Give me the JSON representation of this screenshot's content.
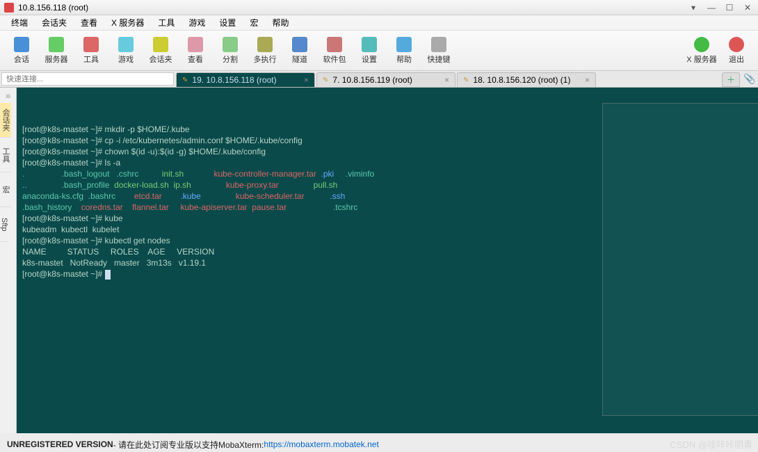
{
  "window": {
    "title": "10.8.156.118 (root)"
  },
  "menubar": [
    "终端",
    "会话夹",
    "查看",
    "X 服务器",
    "工具",
    "游戏",
    "设置",
    "宏",
    "帮助"
  ],
  "toolbar": [
    {
      "label": "会话",
      "color": "#4a90d9"
    },
    {
      "label": "服务器",
      "color": "#6c6"
    },
    {
      "label": "工具",
      "color": "#d66"
    },
    {
      "label": "游戏",
      "color": "#6cd"
    },
    {
      "label": "会话夹",
      "color": "#cc3"
    },
    {
      "label": "查看",
      "color": "#d9a"
    },
    {
      "label": "分割",
      "color": "#8c8"
    },
    {
      "label": "多执行",
      "color": "#aa5"
    },
    {
      "label": "隧道",
      "color": "#58c"
    },
    {
      "label": "软件包",
      "color": "#c77"
    },
    {
      "label": "设置",
      "color": "#5bb"
    },
    {
      "label": "帮助",
      "color": "#5ad"
    },
    {
      "label": "快捷键",
      "color": "#aaa"
    }
  ],
  "toolbar_right": [
    {
      "label": "X 服务器",
      "color": "#4b4"
    },
    {
      "label": "退出",
      "color": "#d55"
    }
  ],
  "quick_connect_placeholder": "快速连接...",
  "tabs": [
    {
      "label": "19. 10.8.156.118 (root)",
      "active": true
    },
    {
      "label": "7. 10.8.156.119 (root)",
      "active": false
    },
    {
      "label": "18. 10.8.156.120 (root) (1)",
      "active": false
    }
  ],
  "sidebar": [
    {
      "label": "会话夹",
      "cls": "y"
    },
    {
      "label": "工具",
      "cls": ""
    },
    {
      "label": "宏",
      "cls": ""
    },
    {
      "label": "Sftp",
      "cls": ""
    }
  ],
  "terminal": {
    "lines": [
      {
        "t": "[root@k8s-mastet ~]# mkdir -p $HOME/.kube",
        "seg": [
          [
            "p",
            "[root@k8s-mastet ~]# mkdir -p $HOME/.kube"
          ]
        ]
      },
      {
        "t": "",
        "seg": [
          [
            "p",
            "[root@k8s-mastet ~]# cp -i /etc/kubernetes/admin.conf $HOME/.kube/config"
          ]
        ]
      },
      {
        "t": "",
        "seg": [
          [
            "p",
            "[root@k8s-mastet ~]# chown $(id -u):$(id -g) $HOME/.kube/config"
          ]
        ]
      },
      {
        "t": "",
        "seg": [
          [
            "p",
            "[root@k8s-mastet ~]# ls -a"
          ]
        ]
      },
      {
        "t": "",
        "seg": [
          [
            "c-blue",
            ".                "
          ],
          [
            "c-cyan",
            ".bash_logout   "
          ],
          [
            "c-cyan",
            ".cshrc          "
          ],
          [
            "c-green",
            "init.sh             "
          ],
          [
            "c-red",
            "kube-controller-manager.tar  "
          ],
          [
            "c-blue",
            ".pki     "
          ],
          [
            "c-cyan",
            ".viminfo"
          ]
        ]
      },
      {
        "t": "",
        "seg": [
          [
            "c-blue",
            "..               "
          ],
          [
            "c-cyan",
            ".bash_profile  "
          ],
          [
            "c-green",
            "docker-load.sh  "
          ],
          [
            "c-green",
            "ip.sh               "
          ],
          [
            "c-red",
            "kube-proxy.tar               "
          ],
          [
            "c-green",
            "pull.sh"
          ]
        ]
      },
      {
        "t": "",
        "seg": [
          [
            "c-cyan",
            "anaconda-ks.cfg  "
          ],
          [
            "c-cyan",
            ".bashrc        "
          ],
          [
            "c-red",
            "etcd.tar        "
          ],
          [
            "c-blue",
            ".kube               "
          ],
          [
            "c-red",
            "kube-scheduler.tar           "
          ],
          [
            "c-blue",
            ".ssh"
          ]
        ]
      },
      {
        "t": "",
        "seg": [
          [
            "c-cyan",
            ".bash_history    "
          ],
          [
            "c-red",
            "coredns.tar    "
          ],
          [
            "c-red",
            "flannel.tar     "
          ],
          [
            "c-red",
            "kube-apiserver.tar  "
          ],
          [
            "c-red",
            "pause.tar                    "
          ],
          [
            "c-cyan",
            ".tcshrc"
          ]
        ]
      },
      {
        "t": "",
        "seg": [
          [
            "p",
            "[root@k8s-mastet ~]# kube"
          ]
        ]
      },
      {
        "t": "",
        "seg": [
          [
            "p",
            "kubeadm  kubectl  kubelet"
          ]
        ]
      },
      {
        "t": "",
        "seg": [
          [
            "p",
            "[root@k8s-mastet ~]# kubectl get nodes"
          ]
        ]
      },
      {
        "t": "",
        "seg": [
          [
            "p",
            "NAME         STATUS     ROLES    AGE     VERSION"
          ]
        ]
      },
      {
        "t": "",
        "seg": [
          [
            "p",
            "k8s-mastet   NotReady   master   3m13s   v1.19.1"
          ]
        ]
      },
      {
        "t": "",
        "seg": [
          [
            "p",
            "[root@k8s-mastet ~]# "
          ],
          [
            "cursor",
            ""
          ]
        ]
      }
    ]
  },
  "footer": {
    "bold": "UNREGISTERED VERSION",
    "text": " - 请在此处订阅专业版以支持MobaXterm: ",
    "link": "https://mobaxterm.mobatek.net"
  },
  "watermark": "CSDN @哇咔咔明青"
}
